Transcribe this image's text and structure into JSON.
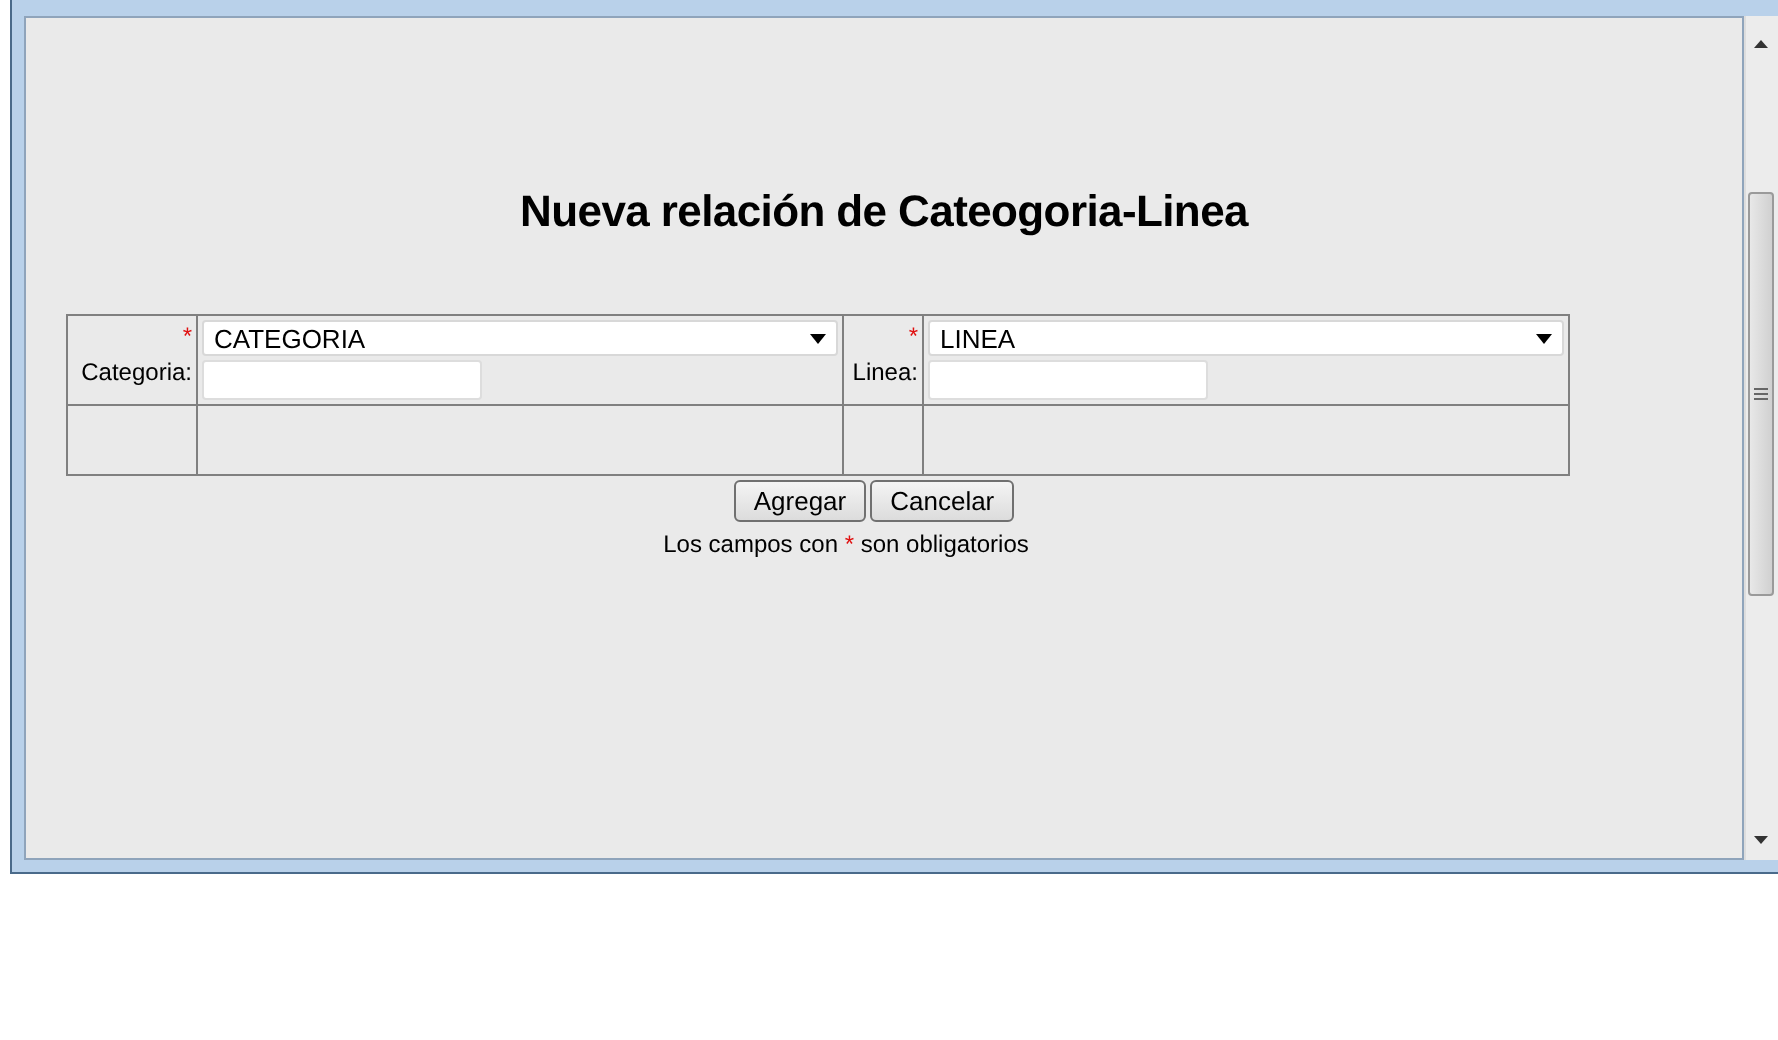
{
  "title": "Nueva relación de Cateogoria-Linea",
  "fields": [
    {
      "required_mark": "*",
      "label": "Categoria:",
      "select_value": "CATEGORIA"
    },
    {
      "required_mark": "*",
      "label": "Linea:",
      "select_value": "LINEA"
    }
  ],
  "buttons": [
    "Agregar",
    "Cancelar"
  ],
  "note": {
    "before": "Los campos con ",
    "mark": "*",
    "after": " son obligatorios"
  }
}
